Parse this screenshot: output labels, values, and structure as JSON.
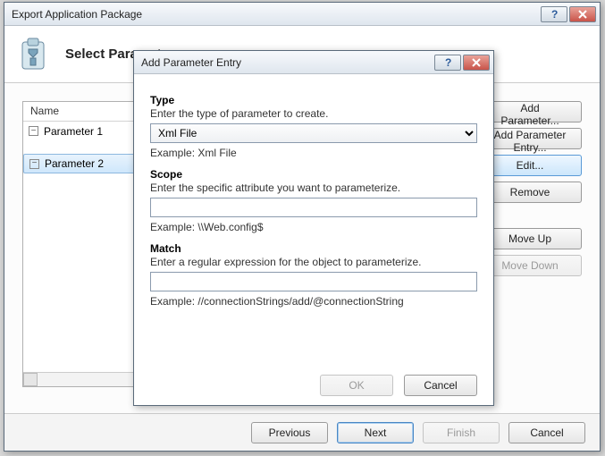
{
  "mainWindow": {
    "title": "Export Application Package",
    "heading": "Select Parameters",
    "treeHeader": "Name",
    "params": [
      "Parameter 1",
      "Parameter 2"
    ],
    "selectedIndex": 1,
    "sideButtons": {
      "addParameter": "Add Parameter...",
      "addEntry": "Add Parameter Entry...",
      "edit": "Edit...",
      "remove": "Remove",
      "moveUp": "Move Up",
      "moveDown": "Move Down"
    },
    "footer": {
      "previous": "Previous",
      "next": "Next",
      "finish": "Finish",
      "cancel": "Cancel"
    }
  },
  "dialog": {
    "title": "Add Parameter Entry",
    "type": {
      "label": "Type",
      "desc": "Enter the type of parameter to create.",
      "value": "Xml File",
      "example": "Example: Xml File"
    },
    "scope": {
      "label": "Scope",
      "desc": "Enter the specific attribute you want to parameterize.",
      "value": "",
      "example": "Example: \\\\Web.config$"
    },
    "match": {
      "label": "Match",
      "desc": "Enter a regular expression for the object to parameterize.",
      "value": "",
      "example": "Example: //connectionStrings/add/@connectionString"
    },
    "buttons": {
      "ok": "OK",
      "cancel": "Cancel"
    }
  }
}
